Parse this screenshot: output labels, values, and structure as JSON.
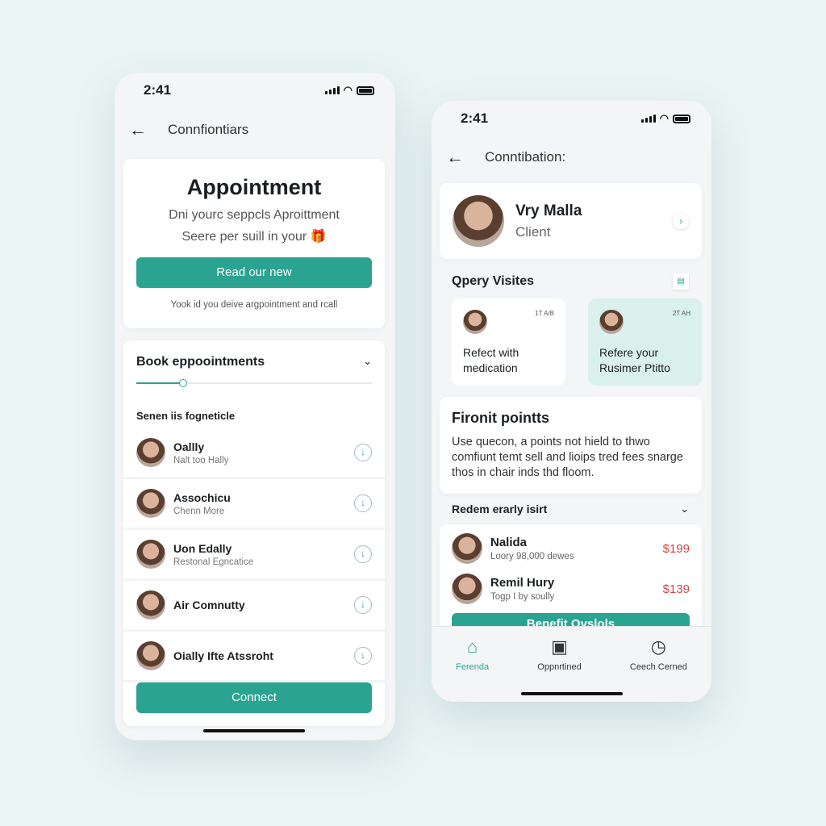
{
  "left": {
    "time": "2:41",
    "nav_title": "Connfiontiars",
    "hero": {
      "title": "Appointment",
      "subtitle_1": "Dni yourc seppcls Aproittment",
      "subtitle_2": "Seere per suill in your",
      "button": "Read our new",
      "note": "Yook id you deive argpointment and rcall"
    },
    "book": {
      "title": "Book eppoointments",
      "progress": 0.2,
      "section": "Senen iis fogneticle",
      "items": [
        {
          "name": "Oallly",
          "sub": "Nalt too Hally"
        },
        {
          "name": "Assochicu",
          "sub": "Chenn More"
        },
        {
          "name": "Uon Edally",
          "sub": "Restonal Egncatice"
        },
        {
          "name": "Air Comnutty",
          "sub": ""
        },
        {
          "name": "Oially Ifte Atssroht",
          "sub": ""
        }
      ],
      "connect": "Connect"
    }
  },
  "right": {
    "time": "2:41",
    "nav_title": "Conntibation:",
    "profile": {
      "name": "Vry Malla",
      "role": "Client"
    },
    "visits": {
      "title": "Qpery Visites",
      "cards": [
        {
          "time": "1T A/B",
          "text": "Refect with medication"
        },
        {
          "time": "2T AH",
          "text": "Refere your Rusimer Ptitto"
        }
      ]
    },
    "points": {
      "title": "Fironit pointts",
      "body": "Use quecon, a points not hield to thwo comfiunt temt sell and lioips tred fees snarge thos in chair inds thd floom."
    },
    "redeem": {
      "title": "Redem erarly isirt",
      "items": [
        {
          "name": "Nalida",
          "sub": "Loory 98,000 dewes",
          "price": "$199"
        },
        {
          "name": "Remil Hury",
          "sub": "Togp I by soully",
          "price": "$139"
        }
      ],
      "button": "Benefit Ovslols"
    },
    "tabs": [
      {
        "label": "Ferenda",
        "icon": "home-icon",
        "active": true
      },
      {
        "label": "Oppnrtined",
        "icon": "box-icon"
      },
      {
        "label": "Ceech Cerned",
        "icon": "clock-icon"
      }
    ]
  },
  "colors": {
    "accent": "#2aa391",
    "price": "#d04545",
    "highlight": "#d9f0ec"
  }
}
